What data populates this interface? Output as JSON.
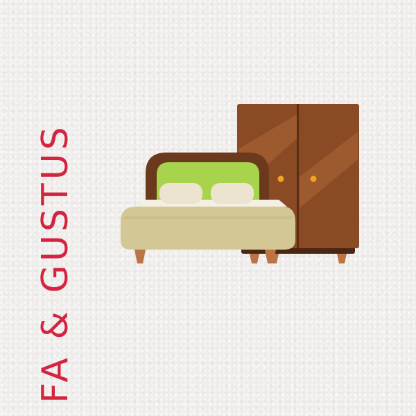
{
  "brand": {
    "name": "FA & GUSTUS",
    "color": "#d4243f"
  },
  "illustration": {
    "icons": [
      "bed-icon",
      "wardrobe-icon",
      "pillow-icon",
      "knob-icon"
    ],
    "colors": {
      "wardrobe_body": "#8a4a24",
      "wardrobe_highlight": "#9c5a2e",
      "wardrobe_shadow": "#6e3a1c",
      "knob": "#f2a21c",
      "headboard_frame": "#6b3a1d",
      "headboard_panel": "#a8d34c",
      "pillow": "#ece4cf",
      "sheet": "#f4efe3",
      "mattress": "#d4c796",
      "mattress_edge": "#c6b781",
      "leg": "#bb7443"
    }
  }
}
